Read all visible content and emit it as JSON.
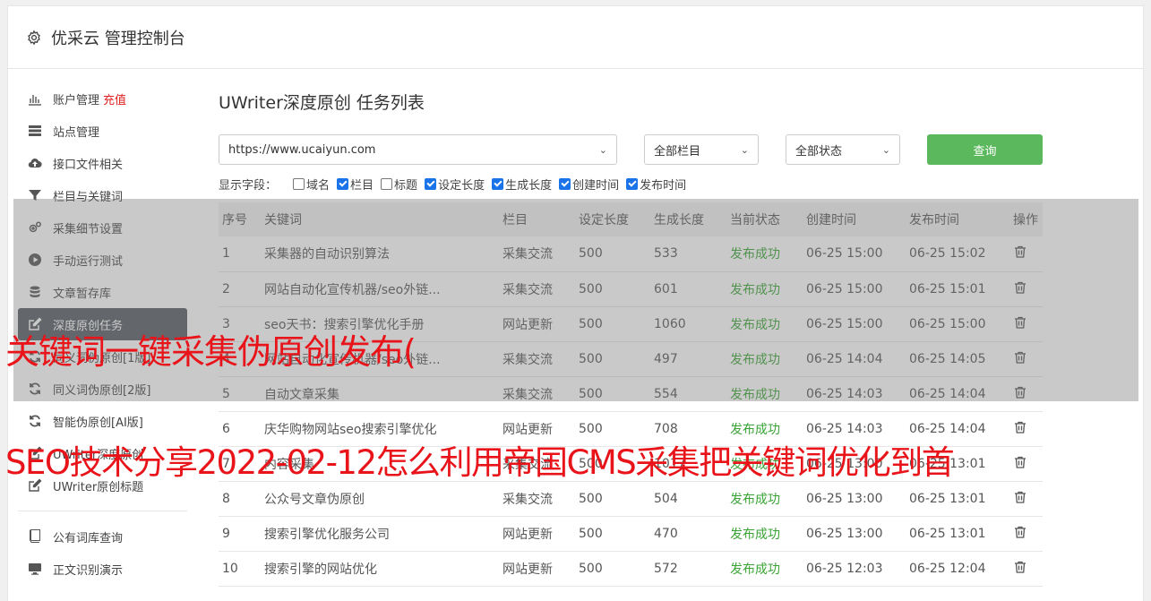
{
  "app": {
    "title": "优采云 管理控制台"
  },
  "sidebar": {
    "items": [
      {
        "label": "账户管理",
        "badge": "充值",
        "icon": "bar-chart-icon"
      },
      {
        "label": "站点管理",
        "icon": "server-icon"
      },
      {
        "label": "接口文件相关",
        "icon": "cloud-upload-icon"
      },
      {
        "label": "栏目与关键词",
        "icon": "filter-icon"
      },
      {
        "label": "采集细节设置",
        "icon": "gears-icon"
      },
      {
        "label": "手动运行测试",
        "icon": "play-circle-icon"
      },
      {
        "label": "文章暂存库",
        "icon": "database-icon"
      },
      {
        "label": "深度原创任务",
        "icon": "edit-icon"
      },
      {
        "label": "同义词伪原创[1版]",
        "icon": "refresh-icon"
      },
      {
        "label": "同义词伪原创[2版]",
        "icon": "refresh-icon"
      },
      {
        "label": "智能伪原创[AI版]",
        "icon": "refresh-icon"
      },
      {
        "label": "UWriter深度原创",
        "icon": "edit-icon"
      },
      {
        "label": "UWriter原创标题",
        "icon": "edit-icon"
      }
    ],
    "items2": [
      {
        "label": "公有词库查询",
        "icon": "book-icon"
      },
      {
        "label": "正文识别演示",
        "icon": "monitor-icon"
      }
    ]
  },
  "main": {
    "title": "UWriter深度原创 任务列表",
    "filters": {
      "url": "https://www.ucaiyun.com",
      "column": "全部栏目",
      "status": "全部状态",
      "query_label": "查询"
    },
    "fields_label": "显示字段：",
    "fields": [
      {
        "label": "域名",
        "checked": false
      },
      {
        "label": "栏目",
        "checked": true
      },
      {
        "label": "标题",
        "checked": false
      },
      {
        "label": "设定长度",
        "checked": true
      },
      {
        "label": "生成长度",
        "checked": true
      },
      {
        "label": "创建时间",
        "checked": true
      },
      {
        "label": "发布时间",
        "checked": true
      }
    ],
    "table": {
      "headers": [
        "序号",
        "关键词",
        "栏目",
        "设定长度",
        "生成长度",
        "当前状态",
        "创建时间",
        "发布时间",
        "操作"
      ],
      "rows": [
        [
          "1",
          "采集器的自动识别算法",
          "采集交流",
          "500",
          "533",
          "发布成功",
          "06-25 15:00",
          "06-25 15:02"
        ],
        [
          "2",
          "网站自动化宣传机器/seo外链...",
          "采集交流",
          "500",
          "601",
          "发布成功",
          "06-25 15:00",
          "06-25 15:01"
        ],
        [
          "3",
          "seo天书：搜索引擎优化手册",
          "网站更新",
          "500",
          "1060",
          "发布成功",
          "06-25 15:00",
          "06-25 15:00"
        ],
        [
          "4",
          "网站自动化宣传机器/seo外链...",
          "采集交流",
          "500",
          "497",
          "发布成功",
          "06-25 14:04",
          "06-25 14:05"
        ],
        [
          "5",
          "自动文章采集",
          "采集交流",
          "500",
          "554",
          "发布成功",
          "06-25 14:03",
          "06-25 14:04"
        ],
        [
          "6",
          "庆华购物网站seo搜索引擎优化",
          "网站更新",
          "500",
          "708",
          "发布成功",
          "06-25 14:03",
          "06-25 14:04"
        ],
        [
          "7",
          "内容采集",
          "采集交流",
          "500",
          "1017",
          "发布成功",
          "06-25 13:00",
          "06-25 13:01"
        ],
        [
          "8",
          "公众号文章伪原创",
          "采集交流",
          "500",
          "504",
          "发布成功",
          "06-25 13:00",
          "06-25 13:01"
        ],
        [
          "9",
          "搜索引擎优化服务公司",
          "网站更新",
          "500",
          "470",
          "发布成功",
          "06-25 13:00",
          "06-25 13:01"
        ],
        [
          "10",
          "搜索引擎的网站优化",
          "网站更新",
          "500",
          "572",
          "发布成功",
          "06-25 12:03",
          "06-25 12:04"
        ]
      ]
    }
  },
  "overlay": {
    "line1": "关键词一键采集伪原创发布(",
    "line2": "SEO技术分享2022-02-12怎么利用帝国CMS采集把关键词优化到首"
  },
  "colors": {
    "accent_green": "#5cb85c",
    "status_green": "#3aa335",
    "overlay_red": "#e8141a",
    "active_nav": "#555b63"
  }
}
